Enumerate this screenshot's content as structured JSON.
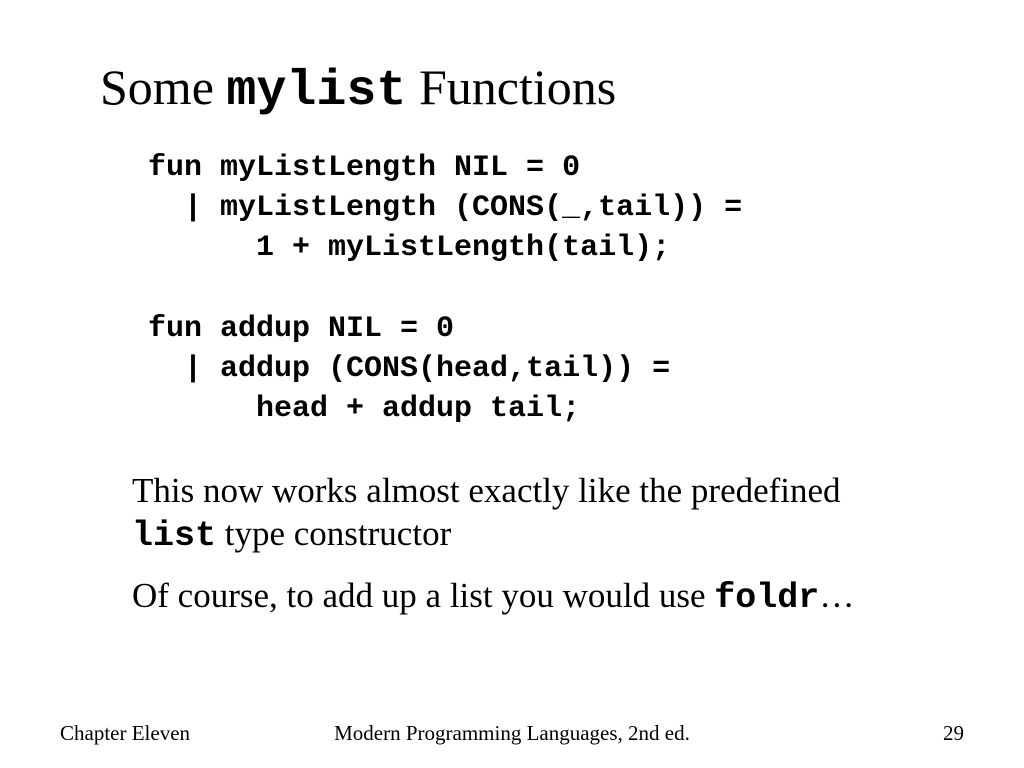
{
  "title": {
    "pre": "Some ",
    "mono": "mylist",
    "post": " Functions"
  },
  "code": "fun myListLength NIL = 0\n  | myListLength (CONS(_,tail)) =\n      1 + myListLength(tail);\n\nfun addup NIL = 0\n  | addup (CONS(head,tail)) =\n      head + addup tail;",
  "bullets": [
    {
      "pre": "This now works almost exactly like the predefined ",
      "mono": "list",
      "post": " type constructor"
    },
    {
      "pre": "Of course, to add up a list you would use ",
      "mono": "foldr",
      "post": "…"
    }
  ],
  "footer": {
    "left": "Chapter Eleven",
    "center": "Modern Programming Languages, 2nd ed.",
    "right": "29"
  }
}
